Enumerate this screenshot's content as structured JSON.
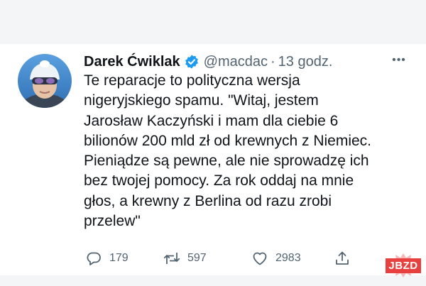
{
  "tweet": {
    "author_name": "Darek Ćwiklak",
    "handle": "@macdac",
    "separator": "·",
    "time": "13 godz.",
    "text_lines": [
      "Te reparacje to polityczna wersja",
      "nigeryjskiego spamu. \"Witaj, jestem",
      "Jarosław Kaczyński i mam dla ciebie 6",
      "bilionów 200 mld zł od krewnych z Niemiec.",
      "Pieniądze są pewne, ale nie sprowadzę ich",
      "bez twojej pomocy. Za rok oddaj na mnie",
      "głos, a krewny z Berlina od razu zrobi",
      "przelew\""
    ],
    "more_icon": "more-horizontal-icon",
    "verified_icon": "verified-badge-icon"
  },
  "actions": {
    "reply": {
      "icon": "reply-icon",
      "count": "179"
    },
    "retweet": {
      "icon": "retweet-icon",
      "count": "597"
    },
    "like": {
      "icon": "heart-icon",
      "count": "2983"
    },
    "share": {
      "icon": "share-icon"
    }
  },
  "watermark": {
    "label": "JBZD",
    "color": "#e8403f"
  },
  "colors": {
    "text": "#0f1419",
    "secondary": "#536471",
    "verified": "#1d9bf0",
    "background": "#f3f5f7"
  }
}
